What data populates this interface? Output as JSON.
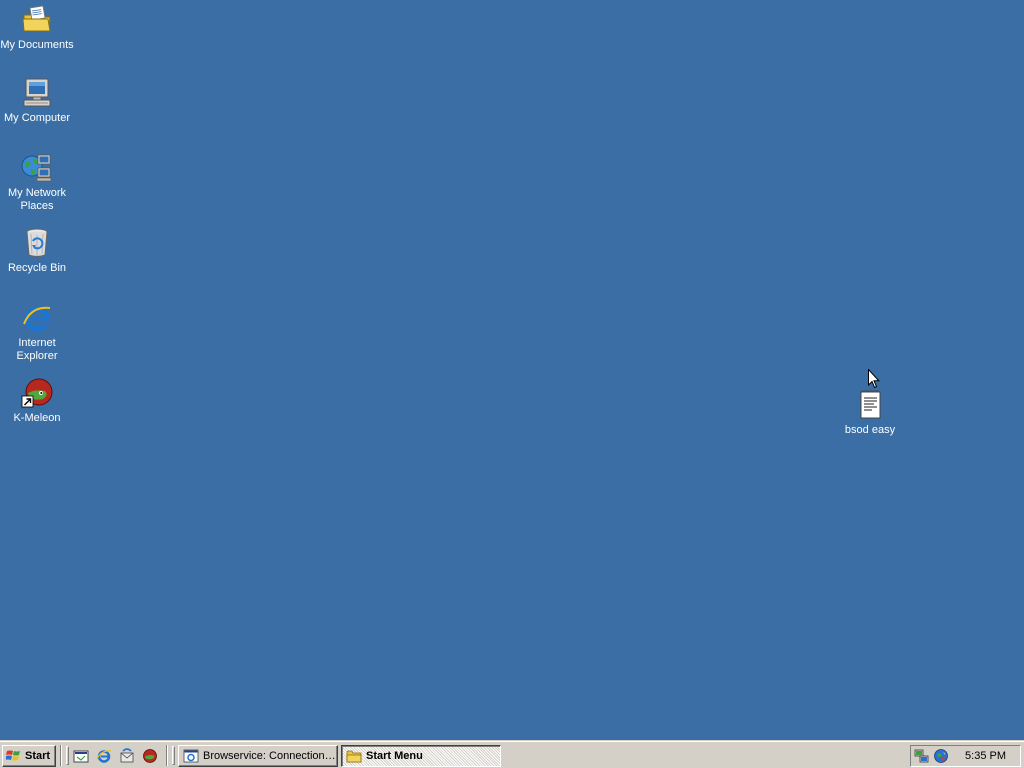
{
  "desktop": {
    "background": "#3a6ea5",
    "icons": [
      {
        "label": "My Documents",
        "icon": "folder-documents-icon"
      },
      {
        "label": "My Computer",
        "icon": "computer-icon"
      },
      {
        "label": "My Network Places",
        "icon": "network-places-icon"
      },
      {
        "label": "Recycle Bin",
        "icon": "recycle-bin-icon"
      },
      {
        "label": "Internet Explorer",
        "icon": "internet-explorer-icon"
      },
      {
        "label": "K-Meleon",
        "icon": "k-meleon-icon"
      },
      {
        "label": "bsod easy",
        "icon": "text-document-icon"
      }
    ]
  },
  "taskbar": {
    "start_label": "Start",
    "quick_launch": [
      "show-desktop-icon",
      "internet-explorer-icon",
      "outlook-express-icon",
      "k-meleon-icon"
    ],
    "tasks": [
      {
        "label": "Browservice: Connection I...",
        "icon": "browser-window-icon",
        "active": false
      },
      {
        "label": "Start Menu",
        "icon": "folder-icon",
        "active": true
      }
    ],
    "tray_icons": [
      "network-icon",
      "volume-icon"
    ],
    "clock": "5:35 PM"
  }
}
